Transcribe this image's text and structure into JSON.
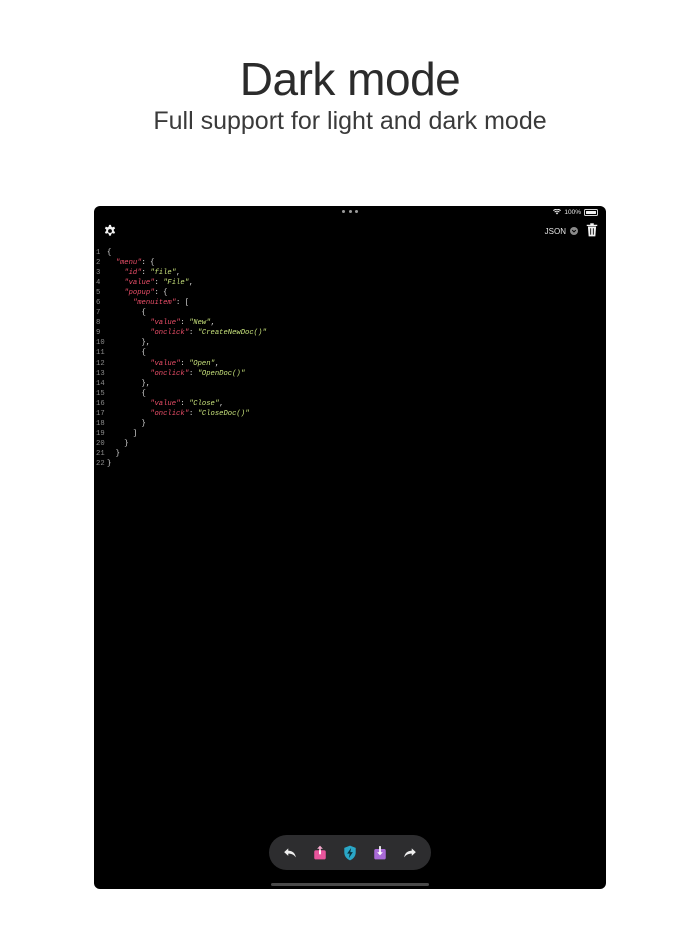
{
  "headline": "Dark mode",
  "subheadline": "Full support for light and dark mode",
  "status_bar": {
    "battery": "100%"
  },
  "toolbar": {
    "format_label": "JSON"
  },
  "editor": {
    "lines": [
      {
        "n": "1",
        "code": "{"
      },
      {
        "n": "2",
        "code": "  \"menu\": {"
      },
      {
        "n": "3",
        "code": "    \"id\": \"file\","
      },
      {
        "n": "4",
        "code": "    \"value\": \"File\","
      },
      {
        "n": "5",
        "code": "    \"popup\": {"
      },
      {
        "n": "6",
        "code": "      \"menuitem\": ["
      },
      {
        "n": "7",
        "code": "        {"
      },
      {
        "n": "8",
        "code": "          \"value\": \"New\","
      },
      {
        "n": "9",
        "code": "          \"onclick\": \"CreateNewDoc()\""
      },
      {
        "n": "10",
        "code": "        },"
      },
      {
        "n": "11",
        "code": "        {"
      },
      {
        "n": "12",
        "code": "          \"value\": \"Open\","
      },
      {
        "n": "13",
        "code": "          \"onclick\": \"OpenDoc()\""
      },
      {
        "n": "14",
        "code": "        },"
      },
      {
        "n": "15",
        "code": "        {"
      },
      {
        "n": "16",
        "code": "          \"value\": \"Close\","
      },
      {
        "n": "17",
        "code": "          \"onclick\": \"CloseDoc()\""
      },
      {
        "n": "18",
        "code": "        }"
      },
      {
        "n": "19",
        "code": "      ]"
      },
      {
        "n": "20",
        "code": "    }"
      },
      {
        "n": "21",
        "code": "  }"
      },
      {
        "n": "22",
        "code": "}"
      }
    ]
  },
  "bottom_bar": {
    "buttons": [
      {
        "name": "undo-button",
        "icon": "undo-arrow-icon"
      },
      {
        "name": "export-button",
        "icon": "share-upload-icon",
        "color": "#e8559c"
      },
      {
        "name": "format-bolt-button",
        "icon": "lightning-shield-icon",
        "color": "#2aa7c7"
      },
      {
        "name": "import-button",
        "icon": "tray-download-icon",
        "color": "#a96bd8"
      },
      {
        "name": "redo-button",
        "icon": "redo-arrow-icon"
      }
    ]
  },
  "colors": {
    "key": "#ee4f6a",
    "string": "#c9e47c",
    "background": "#000000",
    "bar": "#2d2d2f"
  }
}
